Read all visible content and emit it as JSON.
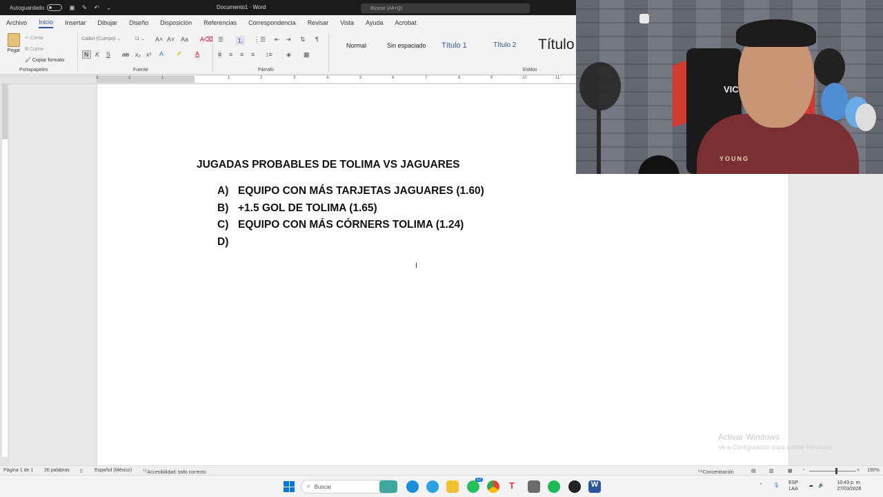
{
  "titlebar": {
    "autosave_label": "Autoguardado",
    "document_title": "Documento1 · Word",
    "search_placeholder": "Buscar (Alt+Q)"
  },
  "menu_tabs": [
    "Archivo",
    "Inicio",
    "Insertar",
    "Dibujar",
    "Diseño",
    "Disposición",
    "Referencias",
    "Correspondencia",
    "Revisar",
    "Vista",
    "Ayuda",
    "Acrobat"
  ],
  "active_tab": "Inicio",
  "ribbon": {
    "clipboard": {
      "paste": "Pegar",
      "cut": "Cortar",
      "copy": "Copiar",
      "format_painter": "Copiar formato",
      "group": "Portapapeles"
    },
    "font": {
      "name": "Calibri (Cuerpo)",
      "size": "11",
      "group": "Fuente"
    },
    "paragraph": {
      "group": "Párrafo"
    },
    "styles": {
      "items": [
        "Normal",
        "Sin espaciado",
        "Título 1",
        "Título 2",
        "Título"
      ],
      "group": "Estilos"
    }
  },
  "document": {
    "heading": "JUGADAS PROBABLES DE TOLIMA VS JAGUARES",
    "items": [
      {
        "marker": "A)",
        "text": "EQUIPO CON MÁS TARJETAS JAGUARES (1.60)"
      },
      {
        "marker": "B)",
        "text": "+1.5 GOL DE TOLIMA (1.65)"
      },
      {
        "marker": "C)",
        "text": "EQUIPO CON MÁS CÓRNERS TOLIMA (1.24)"
      },
      {
        "marker": "D)",
        "text": ""
      }
    ]
  },
  "ruler_numbers": [
    "3",
    "2",
    "1",
    "1",
    "2",
    "3",
    "4",
    "5",
    "6",
    "7",
    "8",
    "9",
    "10",
    "11"
  ],
  "webcam": {
    "chair_text": "VIC",
    "shirt_text": "YOUNG"
  },
  "watermark": {
    "title": "Activar Windows",
    "subtitle": "Ve a Configuración para activar Windows."
  },
  "statusbar": {
    "page": "Página 1 de 1",
    "words": "26 palabras",
    "language": "Español (México)",
    "accessibility": "Accesibilidad: todo correcto",
    "focus": "Concentración",
    "zoom": "190%"
  },
  "taskbar": {
    "search": "Buscar",
    "badge": "12",
    "lang_top": "ESP",
    "lang_bottom": "LAA",
    "time": "10:43 p. m.",
    "date": "27/03/2026"
  }
}
